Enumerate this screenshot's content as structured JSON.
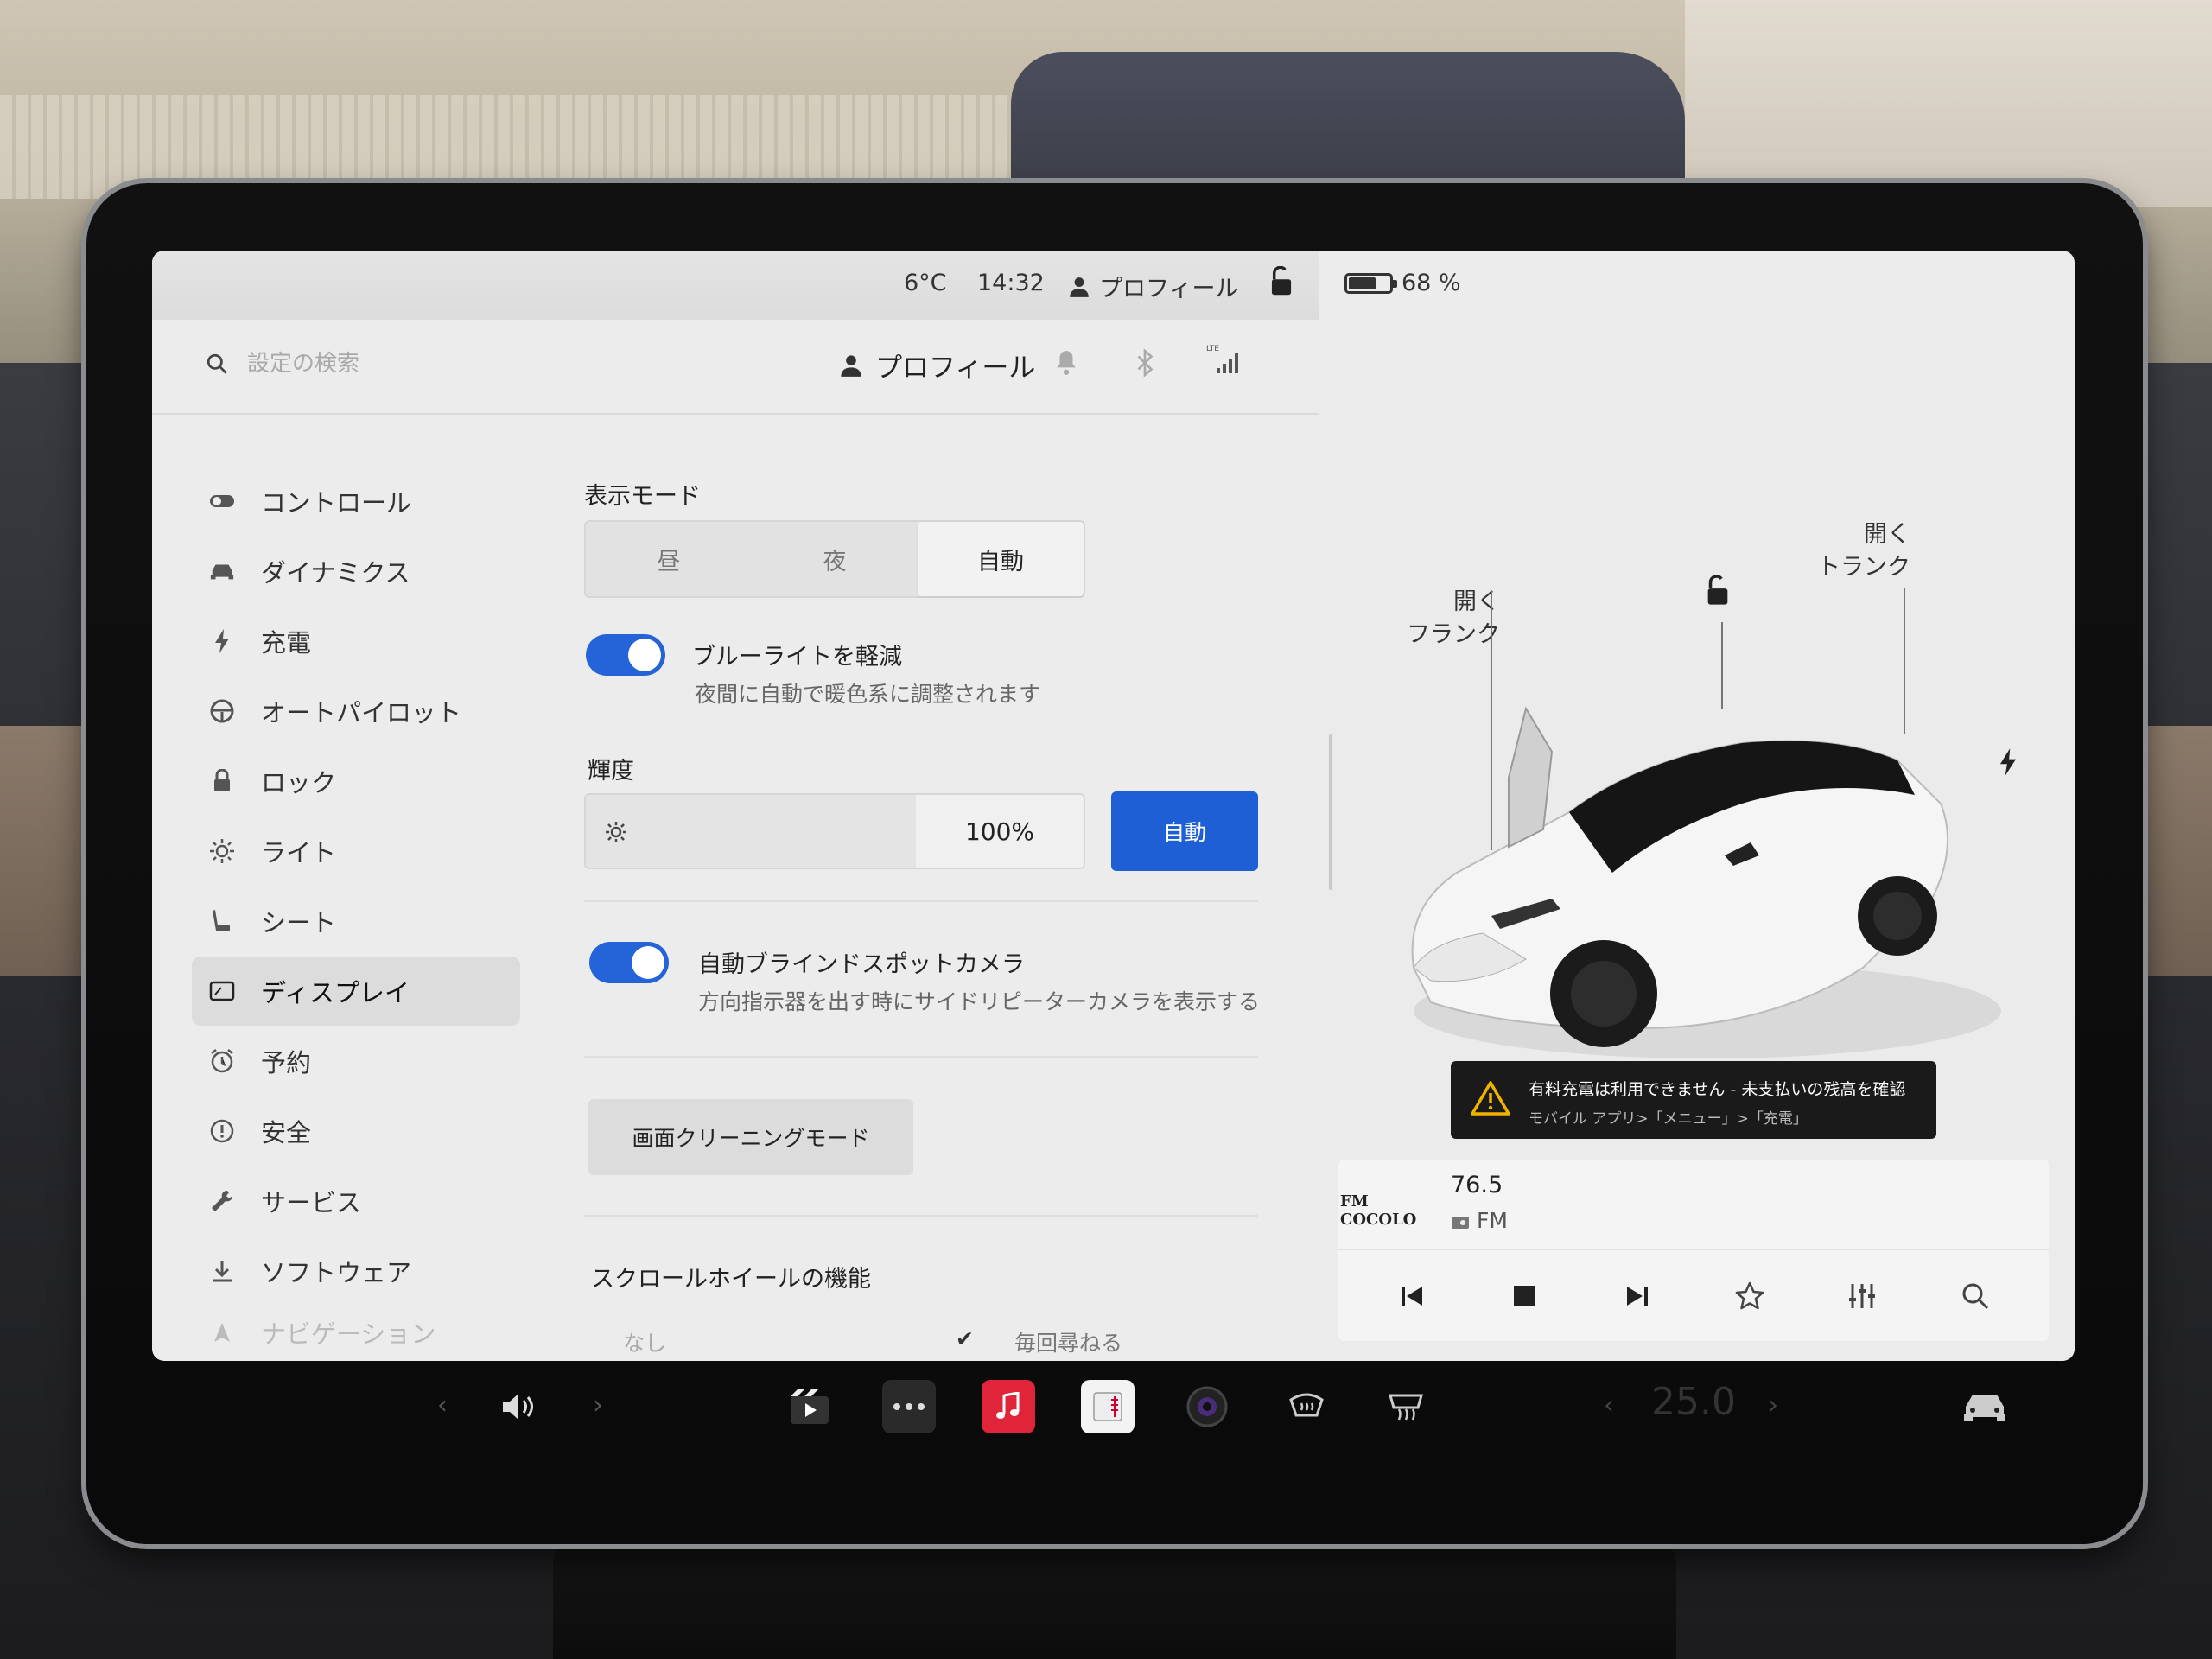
{
  "status": {
    "temperature": "6°C",
    "time": "14:32",
    "profile": "プロフィール",
    "battery_pct_text": "68 %",
    "battery_level": 0.68
  },
  "header": {
    "search_placeholder": "設定の検索",
    "profile": "プロフィール"
  },
  "nav": {
    "items": [
      {
        "label": "コントロール",
        "icon": "toggle-icon"
      },
      {
        "label": "ダイナミクス",
        "icon": "car-icon"
      },
      {
        "label": "充電",
        "icon": "bolt-icon"
      },
      {
        "label": "オートパイロット",
        "icon": "steering-wheel-icon"
      },
      {
        "label": "ロック",
        "icon": "lock-icon"
      },
      {
        "label": "ライト",
        "icon": "sun-icon"
      },
      {
        "label": "シート",
        "icon": "seat-icon"
      },
      {
        "label": "ディスプレイ",
        "icon": "display-icon",
        "active": true
      },
      {
        "label": "予約",
        "icon": "alarm-icon"
      },
      {
        "label": "安全",
        "icon": "info-circle-icon"
      },
      {
        "label": "サービス",
        "icon": "wrench-icon"
      },
      {
        "label": "ソフトウェア",
        "icon": "download-icon"
      },
      {
        "label": "ナビゲーション",
        "icon": "navigation-icon"
      }
    ]
  },
  "display": {
    "mode_label": "表示モード",
    "modes": [
      "昼",
      "夜",
      "自動"
    ],
    "mode_selected": "自動",
    "bluelight_title": "ブルーライトを軽減",
    "bluelight_sub": "夜間に自動で暖色系に調整されます",
    "bluelight_on": true,
    "brightness_label": "輝度",
    "brightness_value": "100%",
    "brightness_level": 1.0,
    "brightness_auto": "自動",
    "blindspot_title": "自動ブラインドスポットカメラ",
    "blindspot_sub": "方向指示器を出す時にサイドリピーターカメラを表示する",
    "blindspot_on": true,
    "cleaning_mode": "画面クリーニングモード",
    "scroll_wheel_label": "スクロールホイールの機能",
    "scroll_opt_none": "なし",
    "scroll_opt_ask": "毎回尋ねる"
  },
  "car": {
    "frunk_open": "開く",
    "frunk": "フランク",
    "trunk_open": "開く",
    "trunk": "トランク",
    "alert_title": "有料充電は利用できません - 未支払いの残高を確認",
    "alert_sub": "モバイル アプリ>「メニュー」>「充電」"
  },
  "media": {
    "station_logo": "FM COCOLO",
    "frequency": "76.5",
    "band": "FM"
  },
  "dock": {
    "cabin_temp": "25.0"
  },
  "colors": {
    "accent_blue": "#1f5fd6",
    "toggle_blue": "#2563d8",
    "music_red": "#e0253a"
  }
}
